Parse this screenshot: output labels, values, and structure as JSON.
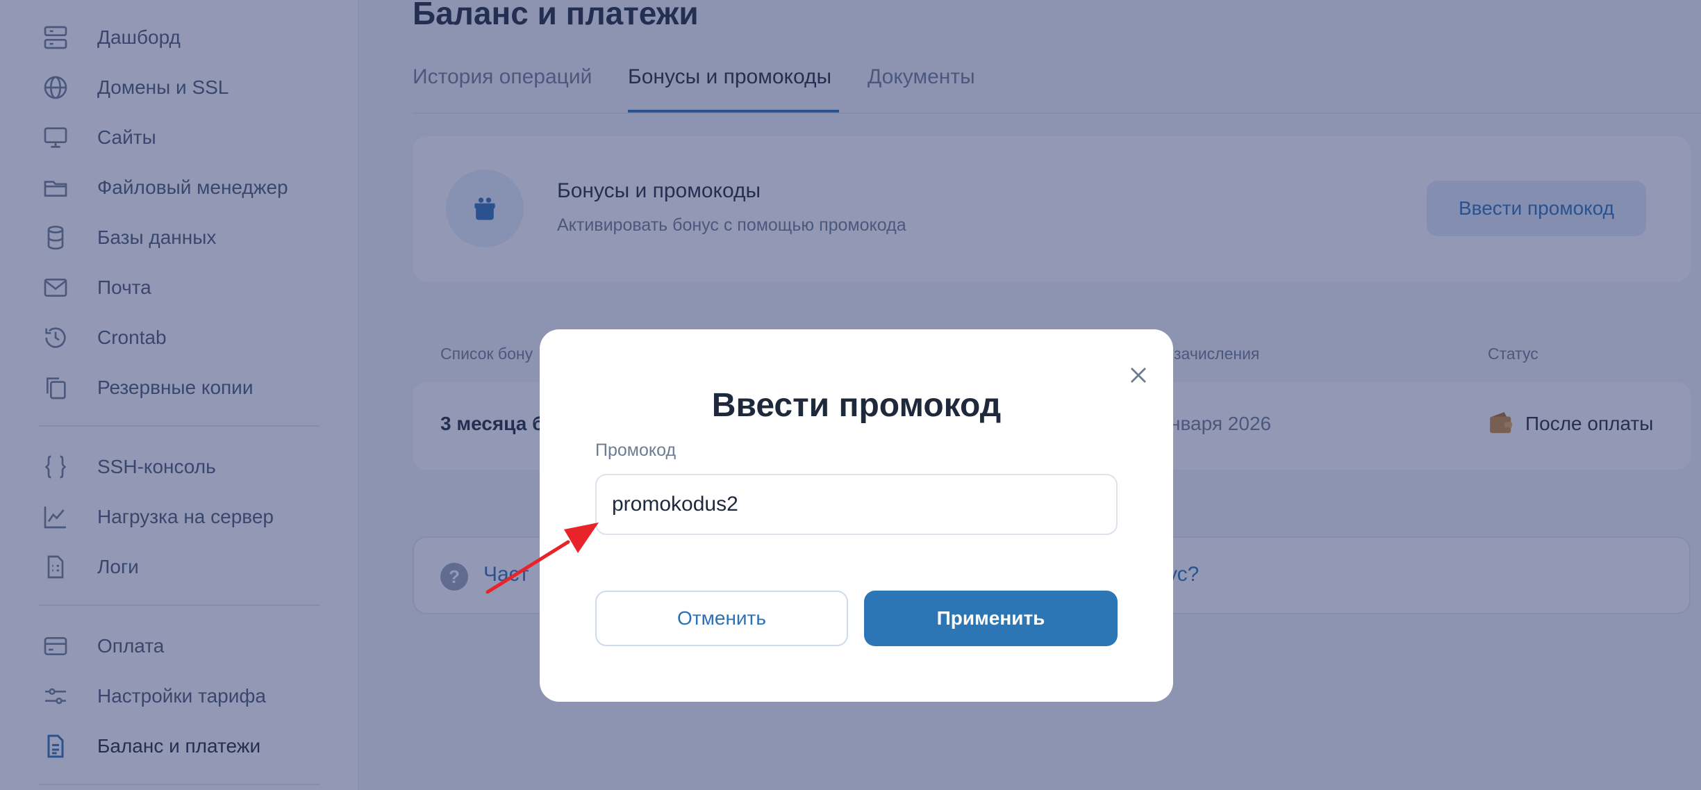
{
  "sidebar": {
    "items": [
      {
        "label": "Дашборд",
        "icon": "server-icon"
      },
      {
        "label": "Домены и SSL",
        "icon": "globe-icon"
      },
      {
        "label": "Сайты",
        "icon": "monitor-icon"
      },
      {
        "label": "Файловый менеджер",
        "icon": "folder-icon"
      },
      {
        "label": "Базы данных",
        "icon": "database-icon"
      },
      {
        "label": "Почта",
        "icon": "mail-icon"
      },
      {
        "label": "Crontab",
        "icon": "history-icon"
      },
      {
        "label": "Резервные копии",
        "icon": "copy-icon"
      },
      {
        "label": "SSH-консоль",
        "icon": "braces-icon"
      },
      {
        "label": "Нагрузка на сервер",
        "icon": "chart-icon"
      },
      {
        "label": "Логи",
        "icon": "log-file-icon"
      },
      {
        "label": "Оплата",
        "icon": "card-icon"
      },
      {
        "label": "Настройки тарифа",
        "icon": "sliders-icon"
      },
      {
        "label": "Баланс и платежи",
        "icon": "document-icon",
        "active": true
      }
    ]
  },
  "page": {
    "title": "Баланс и платежи",
    "tabs": [
      {
        "label": "История операций"
      },
      {
        "label": "Бонусы и промокоды",
        "active": true
      },
      {
        "label": "Документы"
      }
    ]
  },
  "bonus_card": {
    "title": "Бонусы и промокоды",
    "subtitle": "Активировать бонус с помощью промокода",
    "button": "Ввести промокод"
  },
  "list": {
    "headers": {
      "col1": "Список бону",
      "col3": "зачисления",
      "status": "Статус"
    },
    "row": {
      "name": "3 месяца б",
      "date": "нваря 2026",
      "status": "После оплаты"
    }
  },
  "faq": {
    "left": "Част",
    "right": "ус?"
  },
  "modal": {
    "title": "Ввести промокод",
    "field_label": "Промокод",
    "input_value": "promokodus2",
    "cancel": "Отменить",
    "apply": "Применить"
  },
  "colors": {
    "accent": "#2c76b6",
    "overlay": "#283469",
    "annotation_arrow": "#e8232a"
  }
}
